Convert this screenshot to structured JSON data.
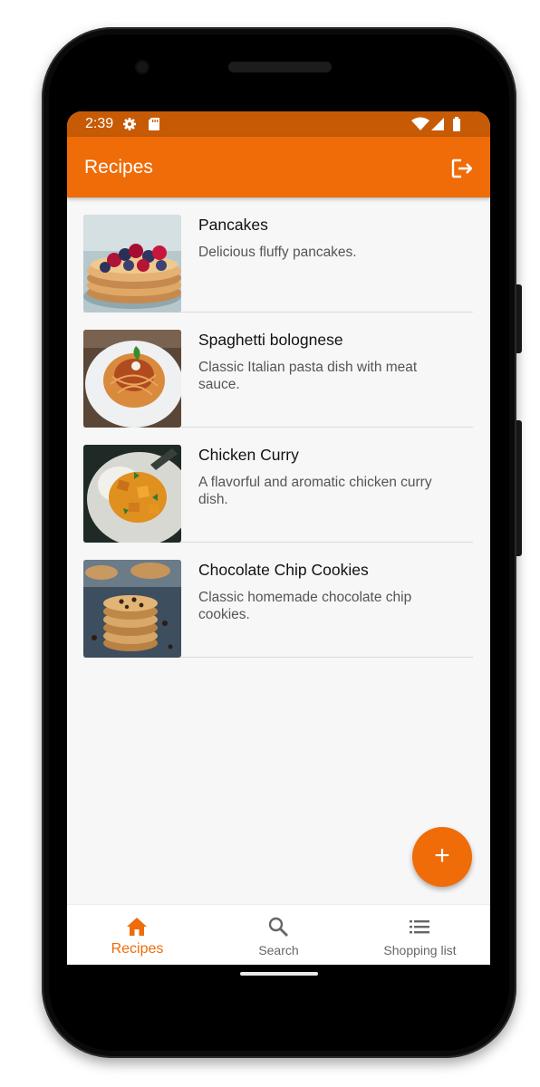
{
  "status_bar": {
    "time": "2:39",
    "icons": [
      "gear-icon",
      "sd-card-icon",
      "wifi-icon",
      "signal-icon",
      "battery-icon"
    ]
  },
  "app_bar": {
    "title": "Recipes",
    "action_icon": "logout-icon"
  },
  "recipes": [
    {
      "title": "Pancakes",
      "description": "Delicious fluffy pancakes.",
      "image": "pancakes-photo"
    },
    {
      "title": "Spaghetti bolognese",
      "description": "Classic Italian pasta dish with meat sauce.",
      "image": "spaghetti-photo"
    },
    {
      "title": "Chicken Curry",
      "description": "A flavorful and aromatic chicken curry dish.",
      "image": "chicken-curry-photo"
    },
    {
      "title": "Chocolate Chip Cookies",
      "description": "Classic homemade chocolate chip cookies.",
      "image": "cookies-photo"
    }
  ],
  "fab": {
    "icon": "plus-icon",
    "glyph": "+"
  },
  "bottom_nav": [
    {
      "label": "Recipes",
      "icon": "home-icon",
      "active": true
    },
    {
      "label": "Search",
      "icon": "search-icon",
      "active": false
    },
    {
      "label": "Shopping list",
      "icon": "list-icon",
      "active": false
    }
  ],
  "colors": {
    "primary": "#ef6c08",
    "status_bar": "#c75a05",
    "background": "#f7f7f7"
  }
}
